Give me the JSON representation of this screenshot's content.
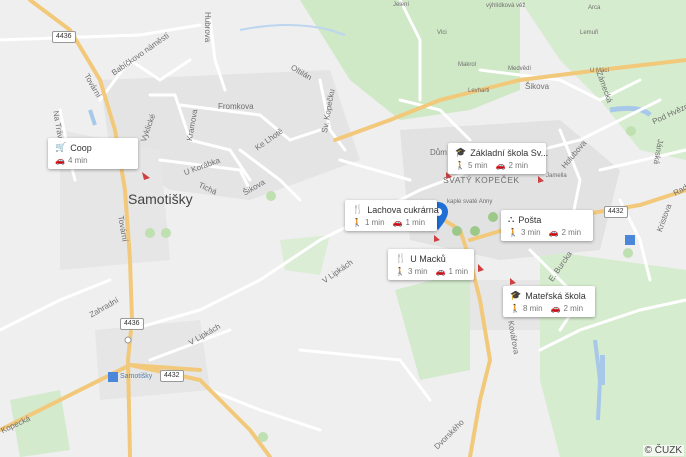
{
  "map": {
    "town_label": "Samotišky",
    "district_label": "SVATÝ KOPEČEK",
    "attribution": "© ČUZK",
    "road_shields": [
      "4436",
      "4436",
      "4432",
      "4432"
    ],
    "street_labels": [
      "Babíčkovo náměstí",
      "Tovární",
      "Vyklické",
      "Kramova",
      "Pomezí",
      "Fromkova",
      "Ke Lhotě",
      "Sv. Kopečku",
      "Oltilán",
      "U Korábka",
      "Tichá",
      "Šikova",
      "Na Trávníku",
      "Tovární",
      "Zahradní",
      "V Lipkách",
      "V Lipkách",
      "Kopecká",
      "Dvorského",
      "Kovářova",
      "E. Burcka",
      "Holubova",
      "Jánská",
      "Zámecká",
      "Šikova",
      "Pod Hvězdárnou",
      "Kristova",
      "Hubrova",
      "Radíkov"
    ],
    "poi_labels": [
      "Dům Jakuba",
      "kaple svaté Anny",
      "Samotišky",
      "Makrol",
      "Medvědí",
      "Levharti",
      "Lemuři",
      "Vlci",
      "U Mácí",
      "Jelení",
      "výhlídková věž",
      "Arca",
      "Jamella"
    ]
  },
  "cards": [
    {
      "icon": "cart-icon",
      "title": "Coop",
      "walk": "",
      "drive": "4 min"
    },
    {
      "icon": "school-icon",
      "title": "Základní škola Sv...",
      "walk": "5 min",
      "drive": "2 min"
    },
    {
      "icon": "restaurant-icon",
      "title": "Lachova cukrárna",
      "walk": "1 min",
      "drive": "1 min"
    },
    {
      "icon": "post-office-icon",
      "title": "Pošta",
      "walk": "3 min",
      "drive": "2 min"
    },
    {
      "icon": "restaurant-icon",
      "title": "U Macků",
      "walk": "3 min",
      "drive": "1 min"
    },
    {
      "icon": "school-icon",
      "title": "Mateřská škola",
      "walk": "8 min",
      "drive": "2 min"
    }
  ],
  "colors": {
    "road_major": "#f2c97a",
    "road_minor": "#ffffff",
    "green": "#c9e6c0",
    "water": "#a8c8ea",
    "pin": "#1f6fd6"
  }
}
